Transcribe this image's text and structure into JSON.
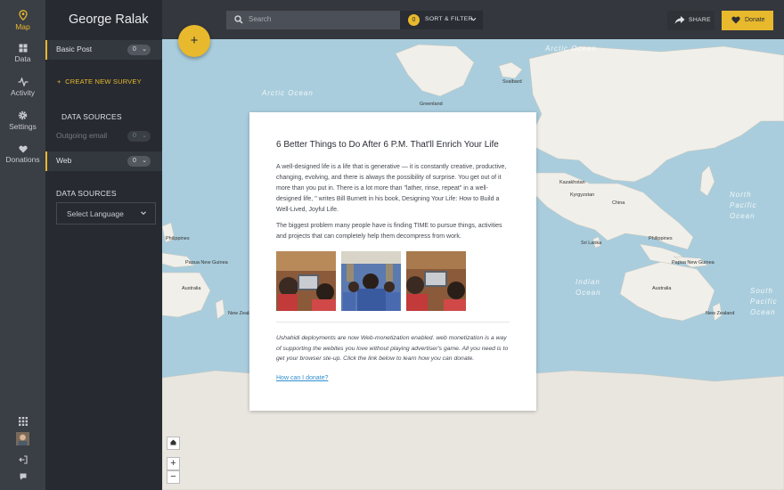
{
  "rail": {
    "items": [
      {
        "label": "Map",
        "icon": "map-pin-icon"
      },
      {
        "label": "Data",
        "icon": "grid-icon"
      },
      {
        "label": "Activity",
        "icon": "activity-icon"
      },
      {
        "label": "Settings",
        "icon": "gear-icon"
      },
      {
        "label": "Donations",
        "icon": "heart-icon"
      }
    ],
    "active_color": "#e8b92d"
  },
  "sidebar": {
    "deployment_name": "George Ralak",
    "modes": [
      {
        "label": "Basic Post",
        "count": "0"
      },
      {
        "label": "Outgoing email",
        "count": "0"
      },
      {
        "label": "Web",
        "count": "0"
      }
    ],
    "create_survey": "CREATE NEW SURVEY",
    "data_sources_title": "DATA SOURCES",
    "data_sources_title_2": "DATA SOURCES",
    "language_select": "Select Language"
  },
  "topbar": {
    "search_placeholder": "Search",
    "filter_count": "0",
    "filter_label": "SORT & FILTER",
    "share_label": "SHARE",
    "donate_label": "Donate"
  },
  "map": {
    "labels": {
      "arctic_ocean_left": "Arctic Ocean",
      "arctic_ocean_right": "Arctic Ocean",
      "north_pacific": [
        "North",
        "Pacific",
        "Ocean"
      ],
      "south_pacific": [
        "South",
        "Pacific",
        "Ocean"
      ],
      "indian_ocean": [
        "Indian",
        "Ocean"
      ],
      "greenland": "Greenland",
      "svalbard": "Svalbard",
      "kazakhstan": "Kazakhstan",
      "kyrgyzstan": "Kyrgyzstan",
      "china": "China",
      "sri_lanka": "Sri Lanka",
      "philippines_left": "Philippines",
      "philippines_right": "Philippines",
      "papua_left": "Papua New Guinea",
      "papua_right": "Papua New Guinea",
      "australia_left": "Australia",
      "australia_right": "Australia",
      "new_zealand_left": "New Zealand",
      "new_zealand_right": "New Zealand"
    },
    "zoom_in": "+",
    "zoom_out": "−",
    "ocean_color": "#a9cddd",
    "land_color": "#f1efe9"
  },
  "modal": {
    "title": "6 Better Things to Do After 6 P.M. That'll Enrich Your Life",
    "paragraph1": "A well-designed life is a life that is generative — it is constantly creative, productive, changing, evolving, and there is always the possibility of surprise. You get out of it more than you put in. There is a lot more than \"lather, rinse, repeat\" in a well-designed life, \" writes Bill Burnett in his book, Designing Your Life: How to Build a Well-Lived, Joyful Life.",
    "paragraph2": "The biggest problem many people have is finding TIME to pursue things, activities and projects that can completely help them decompress from work.",
    "note": "Ushahidi deployments are now Web-monetization enabled. web monetization is a way of supporting the webites you love without playing advertiser's game. All you need is to get your browser ste-up. Click the link below to learn how you can donate.",
    "donate_link": "How can I donate?"
  }
}
